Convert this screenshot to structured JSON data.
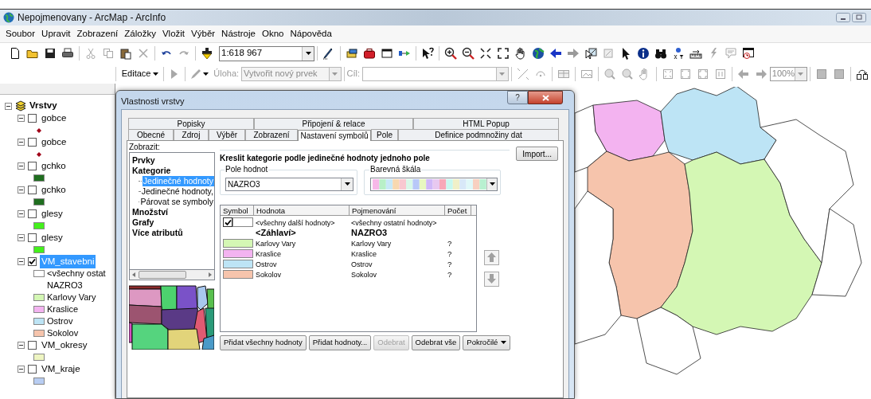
{
  "window": {
    "title": "Nepojmenovany - ArcMap - ArcInfo"
  },
  "menu": [
    "Soubor",
    "Upravit",
    "Zobrazení",
    "Záložky",
    "Vložit",
    "Výběr",
    "Nástroje",
    "Okno",
    "Nápověda"
  ],
  "standard_toolbar": {
    "scale": "1:618 967"
  },
  "editor_toolbar": {
    "menu": "Editace",
    "task_label": "Úloha:",
    "task": "Vytvořit nový prvek",
    "target_label": "Cíl:",
    "zoom": "100%"
  },
  "toc": {
    "root": "Vrstvy",
    "expanded": true,
    "layers": [
      {
        "name": "gobce",
        "checked": false,
        "selected": false,
        "expanded": true,
        "legend": [
          {
            "kind": "point",
            "color": "#a00018"
          }
        ]
      },
      {
        "name": "gobce",
        "checked": false,
        "selected": false,
        "expanded": true,
        "legend": [
          {
            "kind": "point",
            "color": "#a00018"
          }
        ]
      },
      {
        "name": "gchko",
        "checked": false,
        "selected": false,
        "expanded": true,
        "legend": [
          {
            "kind": "fill",
            "color": "#1f6e1f"
          }
        ]
      },
      {
        "name": "gchko",
        "checked": false,
        "selected": false,
        "expanded": true,
        "legend": [
          {
            "kind": "fill",
            "color": "#1f6e1f"
          }
        ]
      },
      {
        "name": "glesy",
        "checked": false,
        "selected": false,
        "expanded": true,
        "legend": [
          {
            "kind": "fill",
            "color": "#44f01c"
          }
        ]
      },
      {
        "name": "glesy",
        "checked": false,
        "selected": false,
        "expanded": true,
        "legend": [
          {
            "kind": "fill",
            "color": "#44f01c"
          }
        ]
      },
      {
        "name": "VM_stavebni",
        "checked": true,
        "selected": true,
        "expanded": true,
        "legend": [
          {
            "kind": "fill",
            "color": "#ffffff",
            "label": "<všechny ostat"
          },
          {
            "kind": "heading",
            "label": "NAZRO3"
          },
          {
            "kind": "fill",
            "color": "#d4f7b4",
            "label": "Karlovy Vary"
          },
          {
            "kind": "fill",
            "color": "#f3b3f0",
            "label": "Kraslice"
          },
          {
            "kind": "fill",
            "color": "#bde4f5",
            "label": "Ostrov"
          },
          {
            "kind": "fill",
            "color": "#f6c4ac",
            "label": "Sokolov"
          }
        ]
      },
      {
        "name": "VM_okresy",
        "checked": false,
        "selected": false,
        "expanded": true,
        "legend": [
          {
            "kind": "fill",
            "color": "#eef5c2"
          }
        ]
      },
      {
        "name": "VM_kraje",
        "checked": false,
        "selected": false,
        "expanded": true,
        "legend": [
          {
            "kind": "fill",
            "color": "#b8cdf2"
          }
        ]
      }
    ]
  },
  "dialog": {
    "title": "Vlastnosti vrstvy",
    "help": "?",
    "tab_rows": [
      [
        {
          "label": "Popisky",
          "selected": false
        },
        {
          "label": "Připojení & relace",
          "selected": false
        },
        {
          "label": "HTML Popup",
          "selected": false
        }
      ],
      [
        {
          "label": "Obecné",
          "selected": false
        },
        {
          "label": "Zdroj",
          "selected": false
        },
        {
          "label": "Výběr",
          "selected": false
        },
        {
          "label": "Zobrazení",
          "selected": false
        },
        {
          "label": "Nastavení symbolů",
          "selected": true
        },
        {
          "label": "Pole",
          "selected": false
        },
        {
          "label": "Definice podmnožiny dat",
          "selected": false
        }
      ]
    ],
    "show_label": "Zobrazit:",
    "show_tree": [
      {
        "label": "Prvky",
        "selected": false
      },
      {
        "label": "Kategorie",
        "selected": false,
        "children": [
          {
            "label": "Jedinečné hodnoty",
            "selected": true
          },
          {
            "label": "Jedinečné hodnoty,",
            "selected": false
          },
          {
            "label": "Párovat se symboly",
            "selected": false
          }
        ]
      },
      {
        "label": "Množství",
        "selected": false
      },
      {
        "label": "Grafy",
        "selected": false
      },
      {
        "label": "Více atributů",
        "selected": false
      }
    ],
    "heading": "Kreslit kategorie podle jedinečné hodnoty jednoho pole",
    "import_button": "Import...",
    "value_field": {
      "label": "Pole hodnot",
      "value": "NAZRO3"
    },
    "color_ramp": {
      "label": "Barevná škála"
    },
    "table": {
      "columns": [
        "Symbol",
        "Hodnota",
        "Pojmenování",
        "Počet"
      ],
      "rows": [
        {
          "kind": "other",
          "checked": true,
          "color": "#ffffff",
          "value": "<všechny další hodnoty>",
          "label": "<všechny ostatní hodnoty>"
        },
        {
          "kind": "heading",
          "value": "<Záhlaví>",
          "label": "NAZRO3"
        },
        {
          "kind": "class",
          "color": "#d4f7b4",
          "value": "Karlovy Vary",
          "label": "Karlovy Vary",
          "count": "?"
        },
        {
          "kind": "class",
          "color": "#f3b3f0",
          "value": "Kraslice",
          "label": "Kraslice",
          "count": "?"
        },
        {
          "kind": "class",
          "color": "#bde4f5",
          "value": "Ostrov",
          "label": "Ostrov",
          "count": "?"
        },
        {
          "kind": "class",
          "color": "#f6c4ac",
          "value": "Sokolov",
          "label": "Sokolov",
          "count": "?"
        }
      ]
    },
    "buttons": [
      {
        "label": "Přidat všechny hodnoty",
        "disabled": false
      },
      {
        "label": "Přidat hodnoty...",
        "disabled": false
      },
      {
        "label": "Odebrat",
        "disabled": true
      },
      {
        "label": "Odebrat vše",
        "disabled": false
      },
      {
        "label": "Pokročilé",
        "disabled": false,
        "menu": true
      }
    ]
  }
}
